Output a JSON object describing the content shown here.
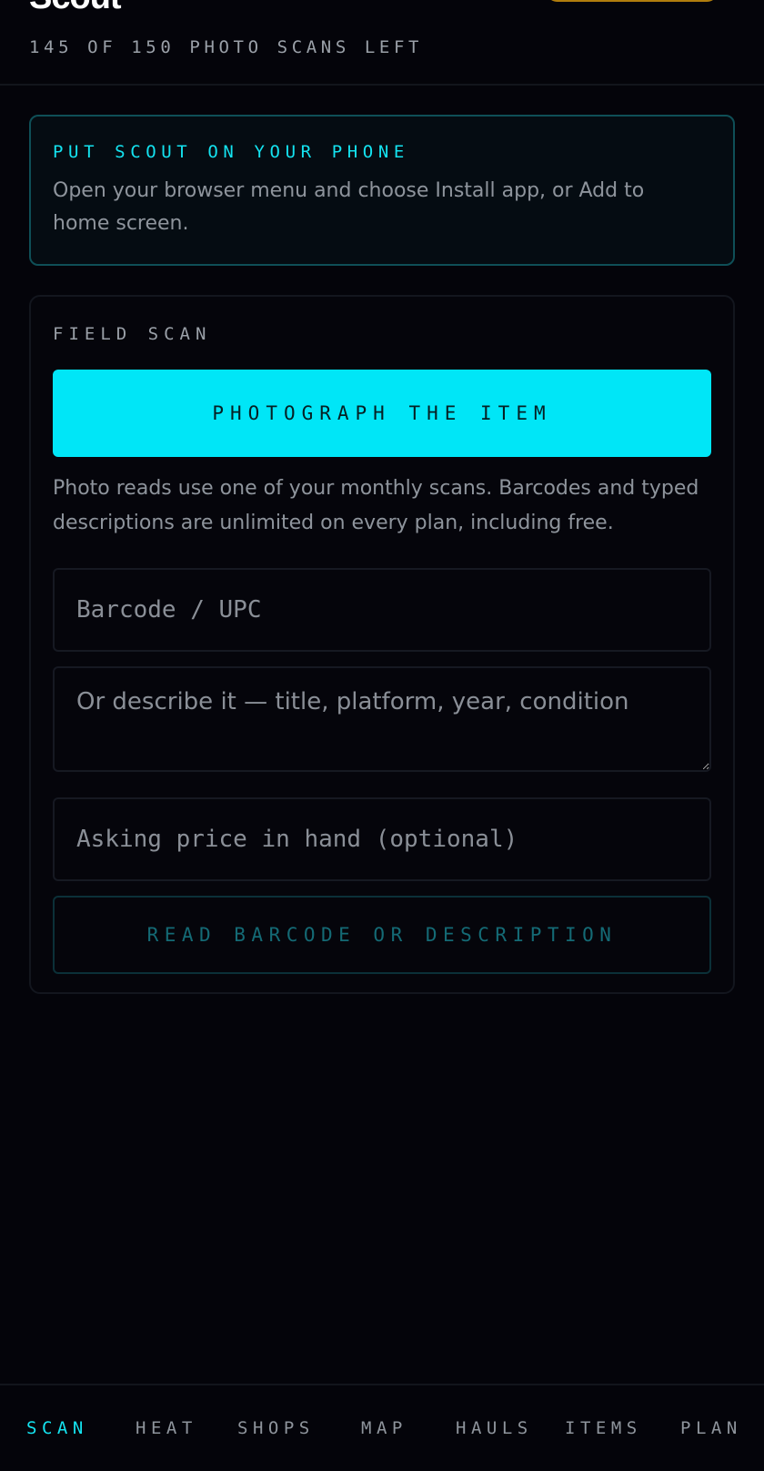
{
  "header": {
    "app_name": "Scout",
    "scan_count": "145 OF 150 PHOTO SCANS LEFT"
  },
  "install_banner": {
    "title": "PUT SCOUT ON YOUR PHONE",
    "text": "Open your browser menu and choose Install app, or Add to home screen."
  },
  "field_scan": {
    "label": "FIELD SCAN",
    "photo_button": "PHOTOGRAPH THE ITEM",
    "photo_note": "Photo reads use one of your monthly scans. Barcodes and typed descriptions are unlimited on every plan, including free.",
    "barcode_placeholder": "Barcode / UPC",
    "barcode_value": "",
    "description_placeholder": "Or describe it — title, platform, year, condition",
    "description_value": "",
    "price_placeholder": "Asking price in hand (optional)",
    "price_value": "",
    "read_button": "READ BARCODE OR DESCRIPTION"
  },
  "bottom_nav": {
    "items": [
      {
        "label": "SCAN",
        "active": true
      },
      {
        "label": "HEAT",
        "active": false
      },
      {
        "label": "SHOPS",
        "active": false
      },
      {
        "label": "MAP",
        "active": false
      },
      {
        "label": "HAULS",
        "active": false
      },
      {
        "label": "ITEMS",
        "active": false
      },
      {
        "label": "PLAN",
        "active": false
      }
    ]
  },
  "colors": {
    "accent": "#00e6f7",
    "background": "#04040a",
    "plan_badge": "#b07d0d"
  }
}
